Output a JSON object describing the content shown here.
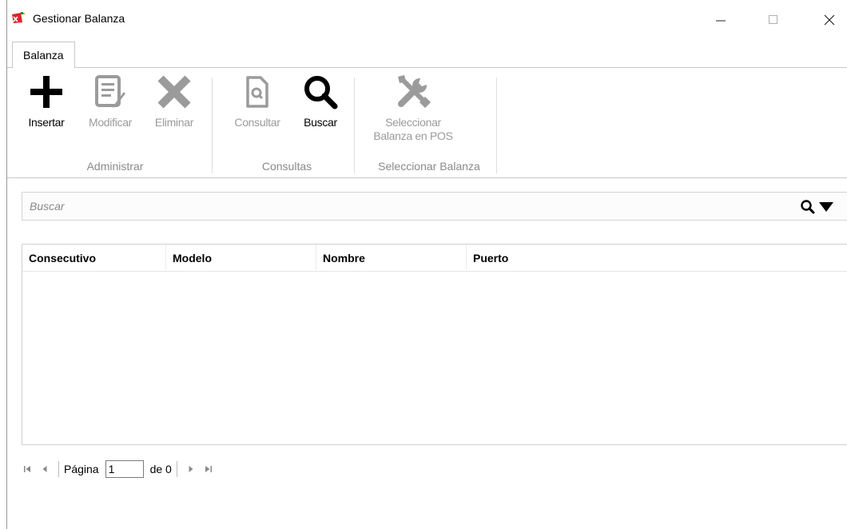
{
  "window": {
    "title": "Gestionar Balanza",
    "icon": "app-logo-icon"
  },
  "tabs": [
    {
      "label": "Balanza",
      "active": true
    }
  ],
  "ribbon": {
    "groups": [
      {
        "label": "Administrar",
        "buttons": [
          {
            "label": "Insertar",
            "icon": "plus-icon",
            "enabled": true
          },
          {
            "label": "Modificar",
            "icon": "edit-document-icon",
            "enabled": false
          },
          {
            "label": "Eliminar",
            "icon": "x-icon",
            "enabled": false
          }
        ]
      },
      {
        "label": "Consultas",
        "buttons": [
          {
            "label": "Consultar",
            "icon": "search-document-icon",
            "enabled": false
          },
          {
            "label": "Buscar",
            "icon": "magnifier-icon",
            "enabled": true
          }
        ]
      },
      {
        "label": "Seleccionar Balanza",
        "buttons": [
          {
            "label_line1": "Seleccionar",
            "label_line2": "Balanza en POS",
            "icon": "tools-icon",
            "enabled": false
          }
        ]
      }
    ]
  },
  "search": {
    "placeholder": "Buscar",
    "value": ""
  },
  "grid": {
    "columns": [
      "Consecutivo",
      "Modelo",
      "Nombre",
      "Puerto"
    ],
    "rows": []
  },
  "pager": {
    "page_label": "Página",
    "current_page": "1",
    "of_label": "de 0"
  },
  "colors": {
    "disabled_text": "#9b9b9b",
    "group_label": "#8a8a8a",
    "border": "#c8c8c8"
  }
}
